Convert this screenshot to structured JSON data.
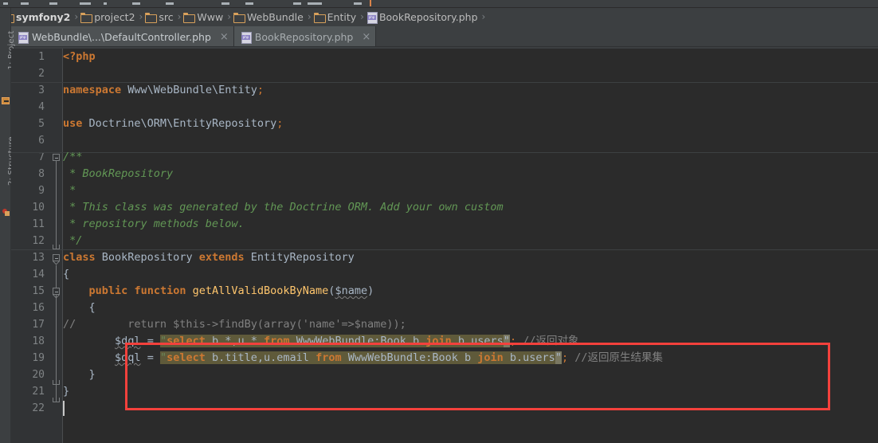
{
  "window": {
    "title": "BookRepository.php"
  },
  "breadcrumb": {
    "name": "breadcrumb",
    "items": [
      {
        "label": "symfony2",
        "icon": "folder-icon",
        "bold": true
      },
      {
        "label": "project2",
        "icon": "folder-icon",
        "bold": false
      },
      {
        "label": "src",
        "icon": "folder-icon",
        "bold": false
      },
      {
        "label": "Www",
        "icon": "folder-icon",
        "bold": false
      },
      {
        "label": "WebBundle",
        "icon": "folder-icon",
        "bold": false
      },
      {
        "label": "Entity",
        "icon": "folder-icon",
        "bold": false
      },
      {
        "label": "BookRepository.php",
        "icon": "php-file-icon",
        "bold": false
      }
    ],
    "separator": "›"
  },
  "tabs": [
    {
      "label": "WebBundle\\...\\DefaultController.php",
      "icon": "php-file-icon",
      "close": "×",
      "active": false
    },
    {
      "label": "BookRepository.php",
      "icon": "php-file-icon",
      "close": "×",
      "active": true
    }
  ],
  "toolwindows": {
    "left": [
      {
        "label": "1: Project",
        "icon": "project-tool-icon"
      },
      {
        "label": "2: Structure",
        "icon": "structure-tool-icon"
      }
    ]
  },
  "editor": {
    "language": "PHP",
    "line_numbers": [
      "1",
      "2",
      "3",
      "4",
      "5",
      "6",
      "7",
      "8",
      "9",
      "10",
      "11",
      "12",
      "13",
      "14",
      "15",
      "16",
      "17",
      "18",
      "19",
      "20",
      "21",
      "22"
    ],
    "lines": [
      {
        "n": 1,
        "text": "<?php"
      },
      {
        "n": 2,
        "text": ""
      },
      {
        "n": 3,
        "text": "namespace Www\\WebBundle\\Entity;"
      },
      {
        "n": 4,
        "text": ""
      },
      {
        "n": 5,
        "text": "use Doctrine\\ORM\\EntityRepository;"
      },
      {
        "n": 6,
        "text": ""
      },
      {
        "n": 7,
        "text": "/**"
      },
      {
        "n": 8,
        "text": " * BookRepository"
      },
      {
        "n": 9,
        "text": " *"
      },
      {
        "n": 10,
        "text": " * This class was generated by the Doctrine ORM. Add your own custom"
      },
      {
        "n": 11,
        "text": " * repository methods below."
      },
      {
        "n": 12,
        "text": " */"
      },
      {
        "n": 13,
        "text": "class BookRepository extends EntityRepository"
      },
      {
        "n": 14,
        "text": "{"
      },
      {
        "n": 15,
        "text": "    public function getAllValidBookByName($name)"
      },
      {
        "n": 16,
        "text": "    {"
      },
      {
        "n": 17,
        "text": "//        return $this->findBy(array('name'=>$name));"
      },
      {
        "n": 18,
        "text": "        $dql = \"select b.*,u.* from WwwWebBundle:Book b join b.users\"; //返回对象"
      },
      {
        "n": 19,
        "text": "        $dql = \"select b.title,u.email from WwwWebBundle:Book b join b.users\"; //返回原生结果集"
      },
      {
        "n": 20,
        "text": "    }"
      },
      {
        "n": 21,
        "text": "}"
      },
      {
        "n": 22,
        "text": ""
      }
    ],
    "tokens": {
      "php_open": "<?php",
      "kw_namespace": "namespace",
      "ns_value": "Www\\WebBundle\\Entity",
      "kw_use": "use",
      "use_value": "Doctrine\\ORM\\EntityRepository",
      "doc_open": "/**",
      "doc_1": " * BookRepository",
      "doc_2": " *",
      "doc_3": " * This class was generated by the Doctrine ORM. Add your own custom",
      "doc_4": " * repository methods below.",
      "doc_close": " */",
      "kw_class": "class",
      "class_name": "BookRepository",
      "kw_extends": "extends",
      "parent_class": "EntityRepository",
      "brace_open": "{",
      "kw_public": "public",
      "kw_function": "function",
      "method_name": "getAllValidBookByName",
      "method_param": "$name",
      "commented_return": "//        return $this->findBy(array('name'=>$name));",
      "line17_comment_marker": "//",
      "line17_body": "        return $this->findBy(array('name'=>$name));",
      "var_dql": "$dql",
      "assign": "=",
      "sql_1": "select b.*,u.* from WwwWebBundle:Book b join b.users",
      "sql_2": "select b.title,u.email from WwwWebBundle:Book b join b.users",
      "quote": "\"",
      "semicolon": ";",
      "cn_comment_1": "//返回对象",
      "cn_comment_2": "//返回原生结果集",
      "brace_close": "}",
      "sql_keywords": [
        "select",
        "from",
        "join"
      ]
    }
  },
  "annotation": {
    "type": "red-rectangle",
    "color": "#f4413c",
    "covers_lines": [
      17,
      18,
      19
    ]
  },
  "colors": {
    "editor_bg": "#2b2b2b",
    "gutter_bg": "#313335",
    "chrome_bg": "#3c3f41",
    "tab_inactive": "#4e5254",
    "tab_active": "#515658",
    "keyword": "#cc7832",
    "method": "#ffc66d",
    "doc_comment": "#629755",
    "line_comment": "#808080",
    "default_text": "#a9b7c6",
    "string_highlight_bg": "#5f5a3a",
    "annotation_red": "#f4413c",
    "folder_icon": "#d9a15b",
    "php_icon": "#8b82c4"
  }
}
